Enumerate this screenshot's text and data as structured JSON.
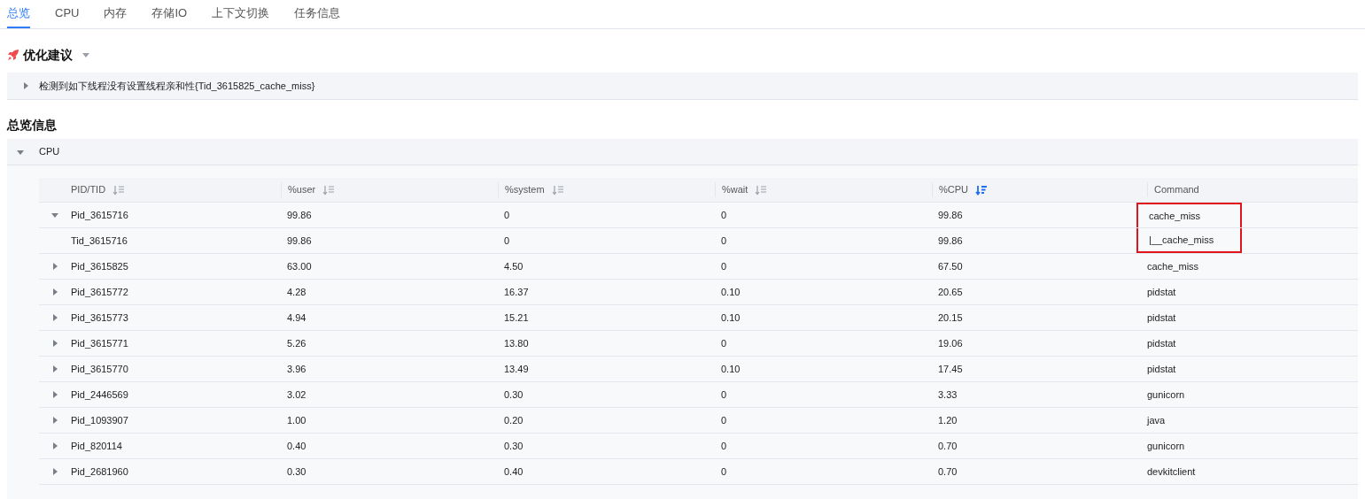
{
  "tabs": [
    {
      "label": "总览",
      "selected": true
    },
    {
      "label": "CPU",
      "selected": false
    },
    {
      "label": "内存",
      "selected": false
    },
    {
      "label": "存储IO",
      "selected": false
    },
    {
      "label": "上下文切换",
      "selected": false
    },
    {
      "label": "任务信息",
      "selected": false
    }
  ],
  "advice": {
    "title": "优化建议",
    "items": [
      {
        "text": "检测到如下线程没有设置线程亲和性{Tid_3615825_cache_miss}",
        "expanded": false
      }
    ]
  },
  "overview": {
    "title": "总览信息",
    "section": {
      "title": "CPU",
      "expanded": true
    },
    "table": {
      "columns": [
        {
          "label": "PID/TID",
          "sortable": true,
          "sorted": false
        },
        {
          "label": "%user",
          "sortable": true,
          "sorted": false
        },
        {
          "label": "%system",
          "sortable": true,
          "sorted": false
        },
        {
          "label": "%wait",
          "sortable": true,
          "sorted": false
        },
        {
          "label": "%CPU",
          "sortable": true,
          "sorted": true
        },
        {
          "label": "Command",
          "sortable": false
        }
      ],
      "rows": [
        {
          "cells": [
            "Pid_3615716",
            "99.86",
            "0",
            "0",
            "99.86",
            "cache_miss"
          ],
          "expanded": true,
          "highlighted": true,
          "children": [
            {
              "cells": [
                "Tid_3615716",
                "99.86",
                "0",
                "0",
                "99.86",
                "|__cache_miss"
              ],
              "highlighted": true
            }
          ]
        },
        {
          "cells": [
            "Pid_3615825",
            "63.00",
            "4.50",
            "0",
            "67.50",
            "cache_miss"
          ],
          "expanded": false,
          "highlighted": false
        },
        {
          "cells": [
            "Pid_3615772",
            "4.28",
            "16.37",
            "0.10",
            "20.65",
            "pidstat"
          ],
          "expanded": false,
          "highlighted": false
        },
        {
          "cells": [
            "Pid_3615773",
            "4.94",
            "15.21",
            "0.10",
            "20.15",
            "pidstat"
          ],
          "expanded": false,
          "highlighted": false
        },
        {
          "cells": [
            "Pid_3615771",
            "5.26",
            "13.80",
            "0",
            "19.06",
            "pidstat"
          ],
          "expanded": false,
          "highlighted": false
        },
        {
          "cells": [
            "Pid_3615770",
            "3.96",
            "13.49",
            "0.10",
            "17.45",
            "pidstat"
          ],
          "expanded": false,
          "highlighted": false
        },
        {
          "cells": [
            "Pid_2446569",
            "3.02",
            "0.30",
            "0",
            "3.33",
            "gunicorn"
          ],
          "expanded": false,
          "highlighted": false
        },
        {
          "cells": [
            "Pid_1093907",
            "1.00",
            "0.20",
            "0",
            "1.20",
            "java"
          ],
          "expanded": false,
          "highlighted": false
        },
        {
          "cells": [
            "Pid_820114",
            "0.40",
            "0.30",
            "0",
            "0.70",
            "gunicorn"
          ],
          "expanded": false,
          "highlighted": false
        },
        {
          "cells": [
            "Pid_2681960",
            "0.30",
            "0.40",
            "0",
            "0.70",
            "devkitclient"
          ],
          "expanded": false,
          "highlighted": false
        }
      ]
    }
  }
}
